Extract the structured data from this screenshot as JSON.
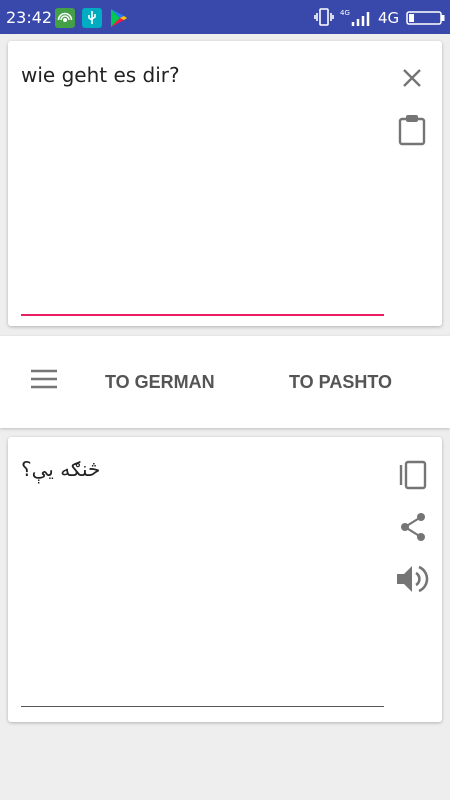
{
  "status_bar": {
    "time": "23:42",
    "network": "4G",
    "icons": [
      "hotspot-icon",
      "usb-icon",
      "play-store-icon",
      "vibrate-icon",
      "signal-icon",
      "battery-icon"
    ],
    "background": "#3949ab"
  },
  "input_card": {
    "text": "wie geht es dir?",
    "underline_color": "#e91e63",
    "icons": [
      "close-icon",
      "clipboard-icon"
    ]
  },
  "language_bar": {
    "to_german_label": "TO GERMAN",
    "to_pashto_label": "TO PASHTO",
    "icons": [
      "menu-icon"
    ]
  },
  "output_card": {
    "text": "څنګه يې؟",
    "icons": [
      "copy-icon",
      "share-icon",
      "volume-icon"
    ]
  }
}
